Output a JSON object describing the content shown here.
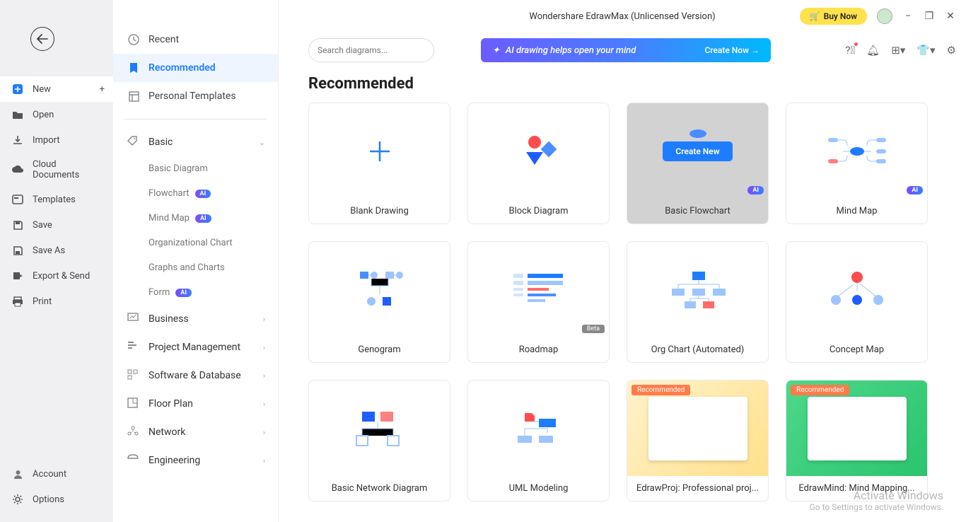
{
  "app_title": "Wondershare EdrawMax (Unlicensed Version)",
  "buy_label": "Buy Now",
  "search": {
    "placeholder": "Search diagrams..."
  },
  "ai_banner": {
    "text": "AI drawing helps open your mind",
    "cta": "Create Now →"
  },
  "left_menu": {
    "new": "New",
    "open": "Open",
    "import": "Import",
    "cloud": "Cloud Documents",
    "templates": "Templates",
    "save": "Save",
    "saveas": "Save As",
    "export": "Export & Send",
    "print": "Print",
    "account": "Account",
    "options": "Options"
  },
  "cat_top": {
    "recent": "Recent",
    "recommended": "Recommended",
    "personal": "Personal Templates"
  },
  "cats": {
    "basic": "Basic",
    "basic_sub": {
      "0": "Basic Diagram",
      "1": "Flowchart",
      "2": "Mind Map",
      "3": "Organizational Chart",
      "4": "Graphs and Charts",
      "5": "Form"
    },
    "business": "Business",
    "project": "Project Management",
    "software": "Software & Database",
    "floor": "Floor Plan",
    "network": "Network",
    "engineering": "Engineering"
  },
  "section_title": "Recommended",
  "cards": {
    "0": {
      "label": "Blank Drawing"
    },
    "1": {
      "label": "Block Diagram"
    },
    "2": {
      "label": "Basic Flowchart",
      "create": "Create New",
      "ai": "AI"
    },
    "3": {
      "label": "Mind Map",
      "ai": "AI"
    },
    "4": {
      "label": "Genogram"
    },
    "5": {
      "label": "Roadmap",
      "beta": "Beta"
    },
    "6": {
      "label": "Org Chart (Automated)"
    },
    "7": {
      "label": "Concept Map"
    },
    "8": {
      "label": "Basic Network Diagram"
    },
    "9": {
      "label": "UML Modeling"
    },
    "10": {
      "label": "EdrawProj: Professional proj...",
      "rec": "Recommended"
    },
    "11": {
      "label": "EdrawMind: Mind Mapping...",
      "rec": "Recommended"
    }
  },
  "ai_badge": "AI",
  "watermark": {
    "title": "Activate Windows",
    "sub": "Go to Settings to activate Windows."
  }
}
